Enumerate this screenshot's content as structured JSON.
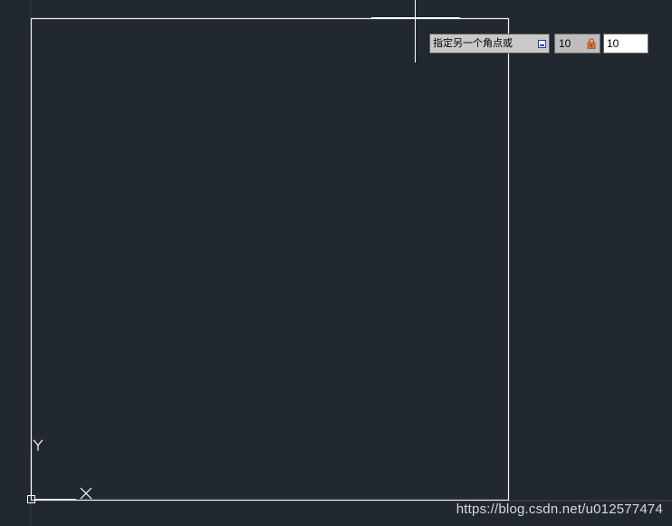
{
  "colors": {
    "background": "#212830",
    "rectangle_stroke": "#f2f2f2",
    "crosshair": "#ffffff",
    "x_axis_hint": "#a05050",
    "y_axis_hint": "#3c7a3c"
  },
  "dynamic_input": {
    "prompt_label": "指定另一个角点或",
    "dropdown_icon": "dropdown-arrow-icon",
    "first_value": "10",
    "lock_icon": "lock-icon",
    "second_value": "10"
  },
  "ucs_icon": {
    "y_label": "Y",
    "x_label": "X"
  },
  "watermark_text": "https://blog.csdn.net/u012577474"
}
